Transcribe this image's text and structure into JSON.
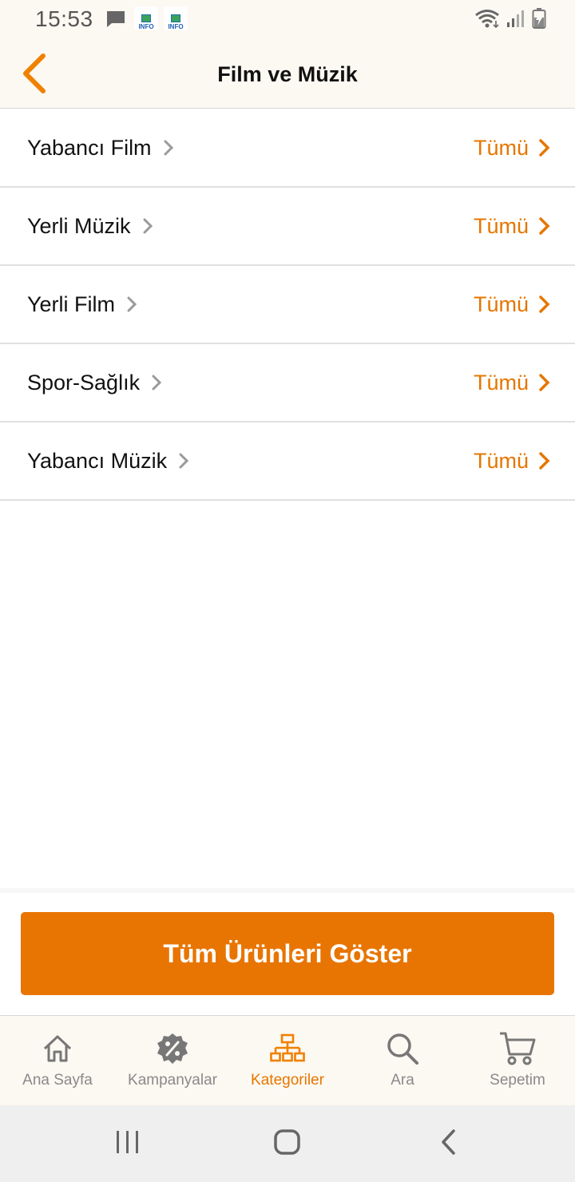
{
  "status_bar": {
    "time": "15:53",
    "info_label": "INFO",
    "icons": [
      "message-icon",
      "info-app-icon",
      "info-app-icon",
      "wifi-icon",
      "signal-icon",
      "battery-icon"
    ]
  },
  "header": {
    "title": "Film ve Müzik",
    "back_icon": "chevron-left-icon"
  },
  "categories": [
    {
      "name": "Yabancı Film",
      "all_label": "Tümü"
    },
    {
      "name": "Yerli Müzik",
      "all_label": "Tümü"
    },
    {
      "name": "Yerli Film",
      "all_label": "Tümü"
    },
    {
      "name": "Spor-Sağlık",
      "all_label": "Tümü"
    },
    {
      "name": "Yabancı Müzik",
      "all_label": "Tümü"
    }
  ],
  "show_all_button": {
    "label": "Tüm Ürünleri Göster"
  },
  "tab_bar": {
    "tabs": [
      {
        "label": "Ana Sayfa",
        "icon": "home-icon",
        "active": false
      },
      {
        "label": "Kampanyalar",
        "icon": "percent-badge-icon",
        "active": false
      },
      {
        "label": "Kategoriler",
        "icon": "category-tree-icon",
        "active": true
      },
      {
        "label": "Ara",
        "icon": "search-icon",
        "active": false
      },
      {
        "label": "Sepetim",
        "icon": "cart-icon",
        "active": false
      }
    ]
  },
  "colors": {
    "accent": "#e67600",
    "button": "#e87502",
    "header_bg": "#fcf8f2",
    "inactive_tab": "#8a8a8a",
    "divider": "#e0e0e0"
  }
}
